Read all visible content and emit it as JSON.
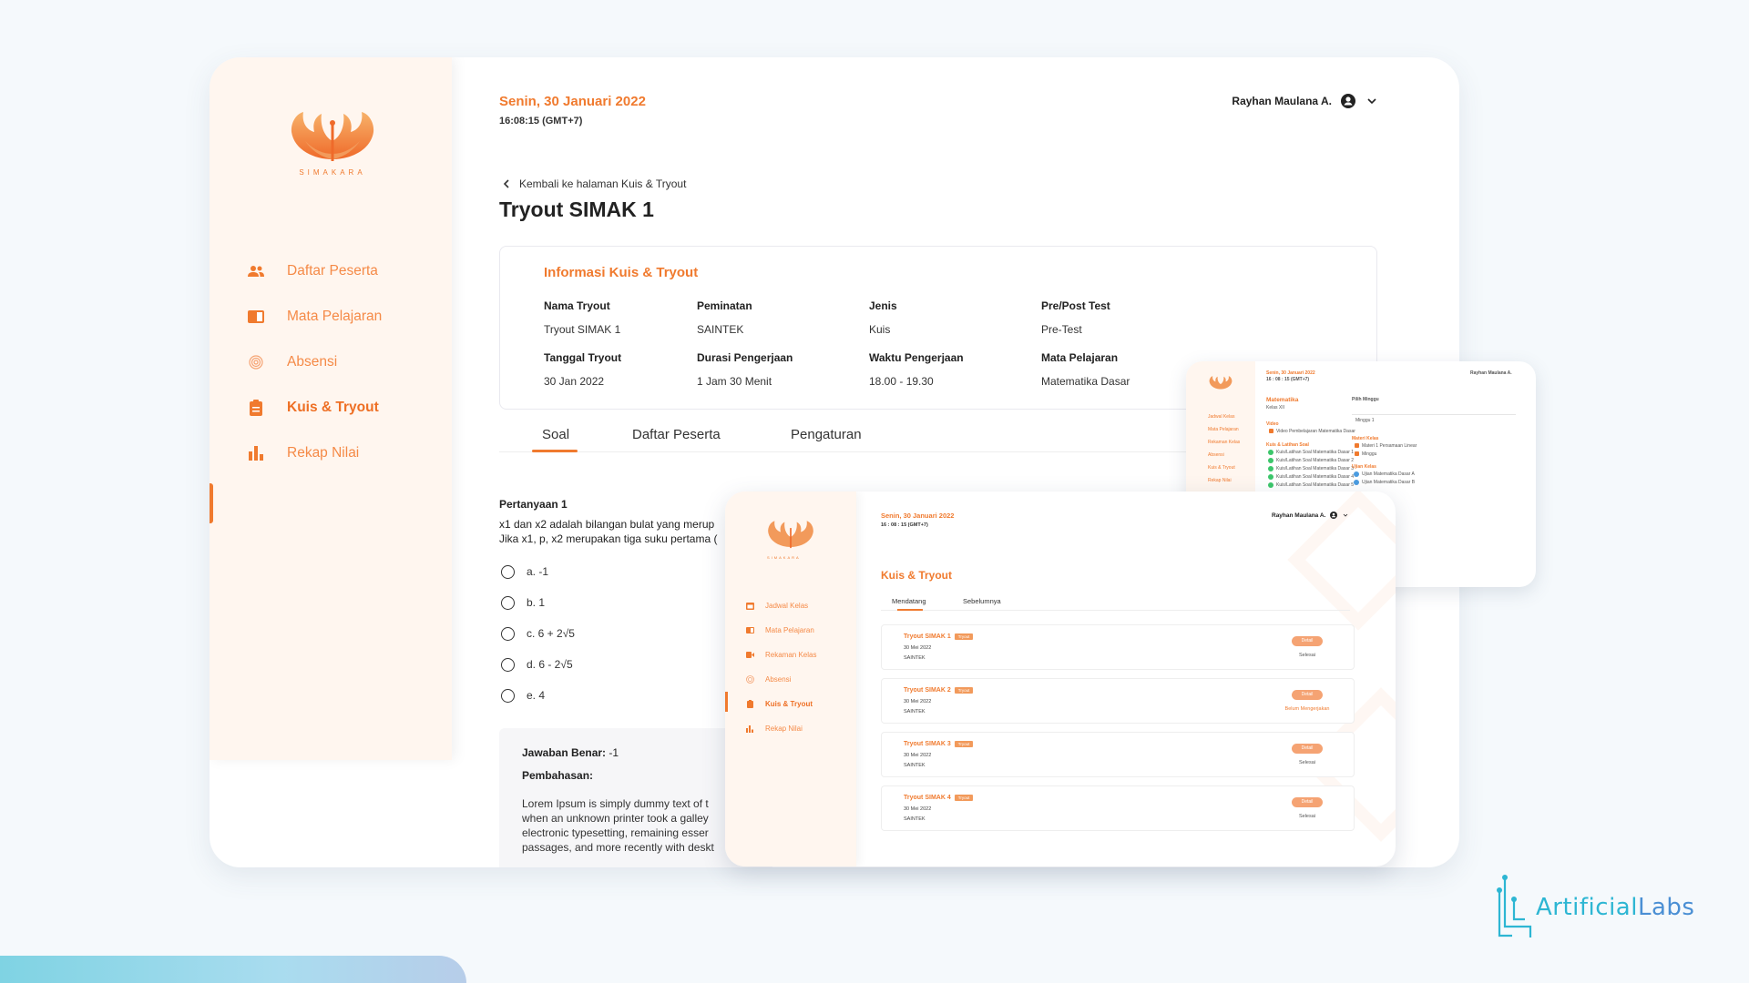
{
  "app": {
    "logo_text": "SIMAKARA",
    "date": "Senin, 30 Januari 2022",
    "time": "16:08:15 (GMT+7)",
    "user_name": "Rayhan Maulana A.",
    "user_icon": "user-circle-icon",
    "dropdown_icon": "chevron-down-icon",
    "accent_color": "#f07a2e"
  },
  "sidebar": {
    "items": [
      {
        "label": "Daftar Peserta",
        "icon": "users-icon"
      },
      {
        "label": "Mata Pelajaran",
        "icon": "book-icon"
      },
      {
        "label": "Absensi",
        "icon": "fingerprint-icon"
      },
      {
        "label": "Kuis & Tryout",
        "icon": "clipboard-icon",
        "active": true
      },
      {
        "label": "Rekap Nilai",
        "icon": "bar-chart-icon"
      }
    ]
  },
  "page": {
    "back_label": "Kembali ke halaman Kuis & Tryout",
    "title": "Tryout SIMAK 1"
  },
  "info": {
    "title": "Informasi Kuis & Tryout",
    "fields": [
      {
        "label": "Nama Tryout",
        "value": "Tryout SIMAK 1"
      },
      {
        "label": "Peminatan",
        "value": "SAINTEK"
      },
      {
        "label": "Jenis",
        "value": "Kuis"
      },
      {
        "label": "Pre/Post Test",
        "value": "Pre-Test"
      },
      {
        "label": "Tanggal Tryout",
        "value": "30 Jan 2022"
      },
      {
        "label": "Durasi Pengerjaan",
        "value": "1 Jam 30 Menit"
      },
      {
        "label": "Waktu Pengerjaan",
        "value": "18.00 - 19.30"
      },
      {
        "label": "Mata Pelajaran",
        "value": "Matematika Dasar"
      }
    ]
  },
  "tabs": [
    "Soal",
    "Daftar Peserta",
    "Pengaturan"
  ],
  "question": {
    "title": "Pertanyaan 1",
    "line1": "x1 dan x2 adalah bilangan bulat yang merup",
    "line2": "Jika x1, p, x2 merupakan tiga suku pertama (",
    "options": [
      "a. -1",
      "b. 1",
      "c. 6 + 2√5",
      "d. 6 - 2√5",
      "e. 4"
    ]
  },
  "answer": {
    "label": "Jawaban Benar:",
    "value": "-1",
    "pembahasan": "Pembahasan:",
    "body": [
      "Lorem Ipsum is simply dummy text of t",
      "when an unknown printer took a galley",
      "electronic typesetting, remaining esser",
      "passages, and more recently with deskt"
    ]
  },
  "small_window": {
    "date": "Senin, 30 Januari 2022",
    "time": "16 : 08 : 15 (GMT+7)",
    "user": "Rayhan Maulana A.",
    "subject": "Matematika",
    "grade": "Kelas XII",
    "video_head": "Video",
    "video_item": "Video Pembelajaran Matematika Dasar",
    "pilih_minggu": "Pilih Minggu",
    "minggu": "Minggu 1",
    "materi_head": "Materi Kelas",
    "materi_1": "Materi 1 Persamaan Linear",
    "materi_2": "Minggu",
    "latihan_head": "Kuis & Latihan Soal",
    "latihan_items": [
      "Kuis/Latihan Soal Matematika Dasar 1",
      "Kuis/Latihan Soal Matematika Dasar 2",
      "Kuis/Latihan Soal Matematika Dasar 3",
      "Kuis/Latihan Soal Matematika Dasar 4",
      "Kuis/Latihan Soal Matematika Dasar 5"
    ],
    "ujian_head": "Ujian Kelas",
    "ujian_items": [
      "Ujian Matematika Dasar A",
      "Ujian Matematika Dasar B"
    ],
    "nav": [
      "Jadwal Kelas",
      "Mata Pelajaran",
      "Rekaman Kelas",
      "Absensi",
      "Kuis & Tryout",
      "Rekap Nilai"
    ]
  },
  "medium_window": {
    "date": "Senin, 30 Januari 2022",
    "time": "16 : 08 : 15 (GMT+7)",
    "user": "Rayhan Maulana A.",
    "title": "Kuis & Tryout",
    "logo_text": "SIMAKARA",
    "tabs": [
      "Mendatang",
      "Sebelumnya"
    ],
    "nav": [
      {
        "label": "Jadwal Kelas",
        "icon": "calendar-icon"
      },
      {
        "label": "Mata Pelajaran",
        "icon": "book-icon"
      },
      {
        "label": "Rekaman Kelas",
        "icon": "video-icon"
      },
      {
        "label": "Absensi",
        "icon": "fingerprint-icon"
      },
      {
        "label": "Kuis & Tryout",
        "icon": "clipboard-icon",
        "active": true
      },
      {
        "label": "Rekap Nilai",
        "icon": "bar-chart-icon"
      }
    ],
    "badge": "Tryout",
    "detail_label": "Detail",
    "cards": [
      {
        "title": "Tryout SIMAK 1",
        "date": "30 Mei 2022",
        "field": "SAINTEK",
        "status": "Selesai"
      },
      {
        "title": "Tryout SIMAK 2",
        "date": "30 Mei 2022",
        "field": "SAINTEK",
        "status": "Belum Mengerjakan"
      },
      {
        "title": "Tryout SIMAK 3",
        "date": "30 Mei 2022",
        "field": "SAINTEK",
        "status": "Selesai"
      },
      {
        "title": "Tryout SIMAK 4",
        "date": "30 Mei 2022",
        "field": "SAINTEK",
        "status": "Selesai"
      }
    ]
  },
  "brand": {
    "part1": "Artificial",
    "part2": "Labs"
  }
}
